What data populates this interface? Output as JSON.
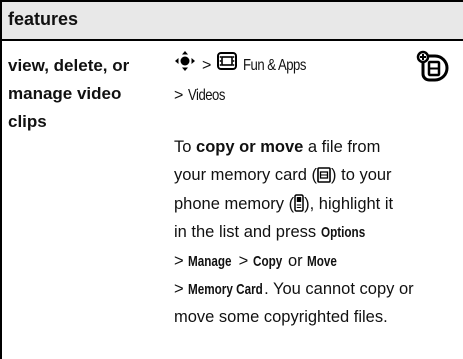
{
  "header": {
    "title": "features"
  },
  "feature": {
    "line1": "view, delete, or",
    "line2": "manage video",
    "line3": "clips"
  },
  "path": {
    "sep1": ">",
    "menu": "Fun & Apps",
    "sep2": ">",
    "item": "Videos"
  },
  "body": {
    "l1_pre": "To ",
    "l1_bold": "copy or move",
    "l1_post": " a file from",
    "l2_pre": "your memory card (",
    "l2_post": ") to your",
    "l3_pre": "phone memory (",
    "l3_post": "), highlight it",
    "l4_pre": "in the list and press ",
    "l4_key": "Options",
    "l5_sep1": "> ",
    "l5_manage": "Manage",
    "l5_sep2": " > ",
    "l5_copy": "Copy",
    "l5_or": " or ",
    "l5_move": "Move",
    "l6_sep": "> ",
    "l6_mem": "Memory Card",
    "l6_post": ". You cannot copy or",
    "l7": "move some copyrighted files."
  },
  "icons": {
    "nav_key": "nav-key-icon",
    "fun_apps": "fun-apps-icon",
    "network_feature": "network-feature-icon",
    "memory_card": "memory-card-icon",
    "phone_memory": "phone-memory-icon"
  }
}
